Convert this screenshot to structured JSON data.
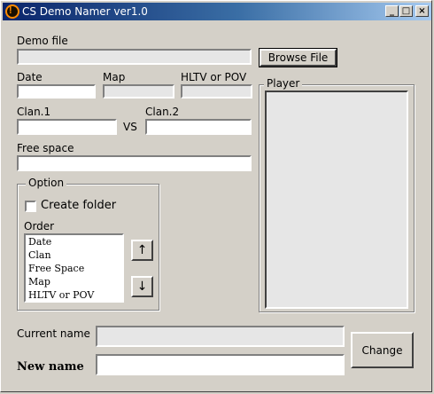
{
  "window": {
    "title": "CS Demo Namer ver1.0",
    "icon_glyph": "!",
    "controls": {
      "minimize": "_",
      "maximize": "□",
      "close": "×"
    }
  },
  "demo_file": {
    "label": "Demo file",
    "value": "",
    "browse_label": "Browse File"
  },
  "fields": {
    "date_label": "Date",
    "map_label": "Map",
    "hltv_label": "HLTV or POV",
    "clan1_label": "Clan.1",
    "vs_label": "VS",
    "clan2_label": "Clan.2",
    "free_space_label": "Free space"
  },
  "option": {
    "group_title": "Option",
    "create_folder_label": "Create folder",
    "create_folder_checked": false,
    "order_label": "Order",
    "order_items": [
      "Date",
      "Clan",
      "Free Space",
      "Map",
      "HLTV or POV"
    ],
    "up_arrow": "↑",
    "down_arrow": "↓"
  },
  "player": {
    "group_title": "Player"
  },
  "naming": {
    "current_name_label": "Current name",
    "new_name_label": "New name",
    "change_label": "Change"
  }
}
